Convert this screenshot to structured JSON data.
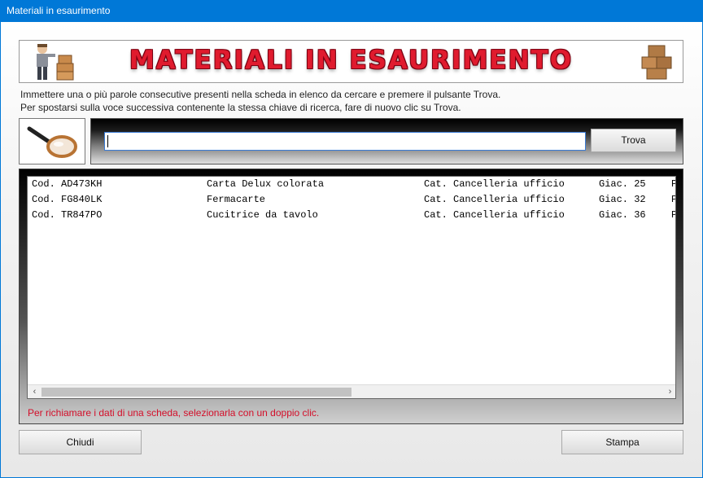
{
  "window": {
    "title": "Materiali in esaurimento"
  },
  "banner": {
    "title": "MATERIALI IN ESAURIMENTO"
  },
  "instructions": {
    "line1": "Immettere una o più parole consecutive presenti nella scheda in elenco da cercare e premere il pulsante Trova.",
    "line2": "Per spostarsi sulla voce successiva contenente la stessa chiave di ricerca, fare di nuovo clic su Trova."
  },
  "search": {
    "value": "",
    "button_label": "Trova"
  },
  "list": {
    "rows": [
      {
        "code": "Cod. AD473KH",
        "name": "Carta Delux colorata",
        "category": "Cat. Cancelleria ufficio",
        "stock": "Giac. 25",
        "extra": "P"
      },
      {
        "code": "Cod. FG840LK",
        "name": "Fermacarte",
        "category": "Cat. Cancelleria ufficio",
        "stock": "Giac. 32",
        "extra": "P"
      },
      {
        "code": "Cod. TR847PO",
        "name": "Cucitrice da tavolo",
        "category": "Cat. Cancelleria ufficio",
        "stock": "Giac. 36",
        "extra": "P"
      }
    ],
    "hint": "Per richiamare i dati di una scheda, selezionarla con un doppio clic."
  },
  "footer": {
    "close_label": "Chiudi",
    "print_label": "Stampa"
  },
  "colors": {
    "titlebar": "#0078d7",
    "banner_text": "#e01b2e",
    "hint_text": "#d40f2a"
  }
}
